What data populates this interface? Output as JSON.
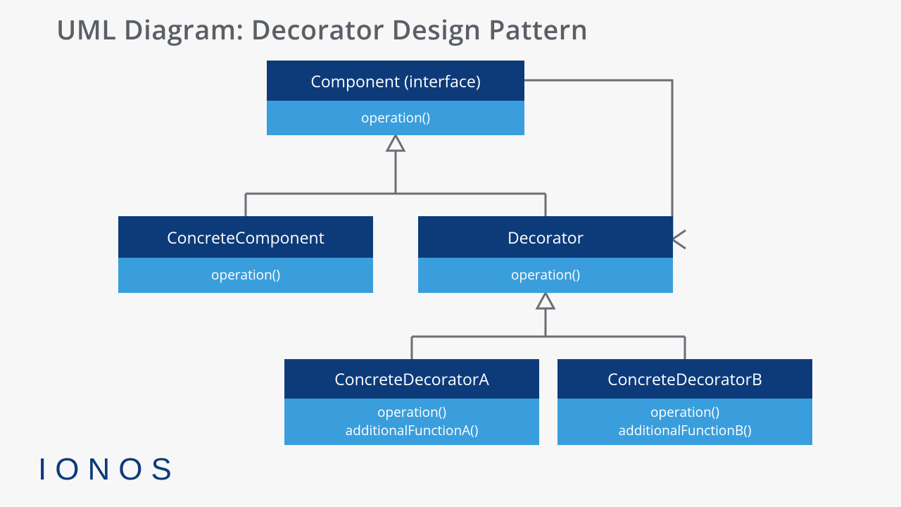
{
  "title": "UML Diagram: Decorator Design Pattern",
  "logo": "IONOS",
  "colors": {
    "head": "#0d3b7a",
    "body": "#3a9edc",
    "connector": "#6a6f75",
    "titleText": "#5a5f66",
    "bg": "#f7f7f7"
  },
  "boxes": {
    "component": {
      "name": "Component (interface)",
      "ops": [
        "operation()"
      ]
    },
    "concreteComponent": {
      "name": "ConcreteComponent",
      "ops": [
        "operation()"
      ]
    },
    "decorator": {
      "name": "Decorator",
      "ops": [
        "operation()"
      ]
    },
    "concreteDecoratorA": {
      "name": "ConcreteDecoratorA",
      "ops": [
        "operation()",
        "additionalFunctionA()"
      ]
    },
    "concreteDecoratorB": {
      "name": "ConcreteDecoratorB",
      "ops": [
        "operation()",
        "additionalFunctionB()"
      ]
    }
  },
  "relationships": [
    {
      "from": "ConcreteComponent",
      "to": "Component",
      "type": "generalization"
    },
    {
      "from": "Decorator",
      "to": "Component",
      "type": "generalization"
    },
    {
      "from": "ConcreteDecoratorA",
      "to": "Decorator",
      "type": "generalization"
    },
    {
      "from": "ConcreteDecoratorB",
      "to": "Decorator",
      "type": "generalization"
    },
    {
      "from": "Decorator",
      "to": "Component",
      "type": "association"
    }
  ]
}
